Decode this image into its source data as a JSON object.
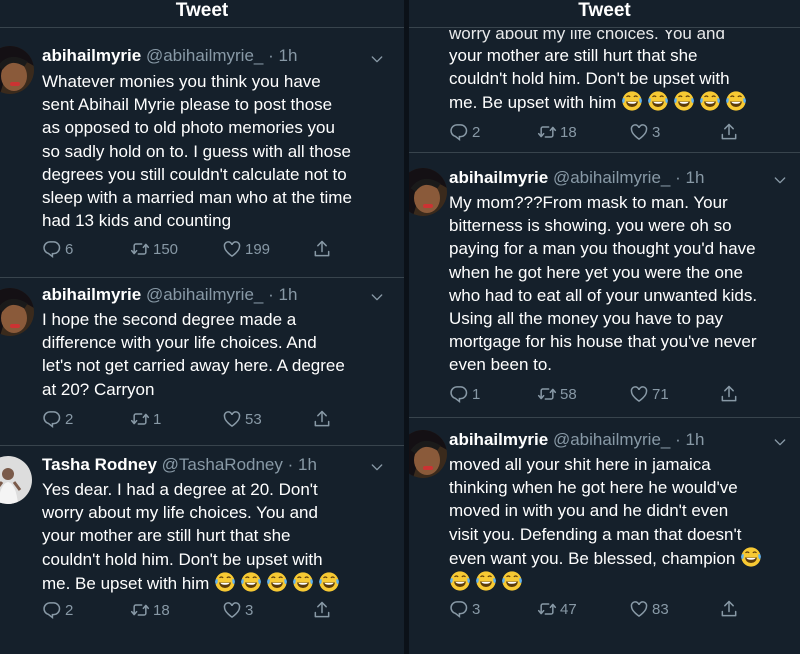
{
  "left": {
    "header": "Tweet",
    "tweets": [
      {
        "name": "abihailmyrie",
        "handle": "@abihailmyrie_",
        "time": "· 1h",
        "text": "Whatever monies you think you have\nsent Abihail Myrie please to post those\nas opposed to old photo memories you\nso sadly hold on to. I guess with all those\ndegrees you still couldn't calculate not to\nsleep with a married man who at the time\nhad 13 kids and counting",
        "replies": "6",
        "retweets": "150",
        "likes": "199"
      },
      {
        "name": "abihailmyrie",
        "handle": "@abihailmyrie_",
        "time": "· 1h",
        "text": "I hope the second degree made a\ndifference with your life choices. And\nlet's not get carried away here. A degree\nat 20? Carryon",
        "replies": "2",
        "retweets": "1",
        "likes": "53"
      },
      {
        "name": "Tasha Rodney",
        "handle": "@TashaRodney",
        "time": "· 1h",
        "text": "Yes dear. I had a degree at 20. Don't\nworry about my life choices. You and\nyour mother are still hurt that she\ncouldn't hold him. Don't be upset with\nme. Be upset with him",
        "replies": "2",
        "retweets": "18",
        "likes": "3"
      }
    ]
  },
  "right": {
    "header": "Tweet",
    "partial": {
      "cut_text": "worry about my life choices. You and",
      "text": "your mother are still hurt that she\ncouldn't hold him. Don't be upset with\nme. Be upset with him",
      "replies": "2",
      "retweets": "18",
      "likes": "3"
    },
    "tweets": [
      {
        "name": "abihailmyrie",
        "handle": "@abihailmyrie_",
        "time": "· 1h",
        "text": "My mom???From mask to man. Your\nbitterness is showing. you were oh so\npaying for a man you thought you'd have\nwhen he got here yet you were the one\nwho had to eat all of your unwanted kids.\nUsing all the money you have to pay\nmortgage for his house that you've never\neven been to.",
        "replies": "1",
        "retweets": "58",
        "likes": "71"
      },
      {
        "name": "abihailmyrie",
        "handle": "@abihailmyrie_",
        "time": "· 1h",
        "text": "moved all your shit here in jamaica\nthinking when he got here he would've\nmoved in with you and he didn't even\nvisit you. Defending a man that doesn't\neven want you. Be blessed, champion",
        "replies": "3",
        "retweets": "47",
        "likes": "83"
      }
    ]
  },
  "icons": {
    "reply": "reply-icon",
    "retweet": "retweet-icon",
    "like": "heart-icon",
    "share": "share-icon",
    "menu": "chevron-down-icon",
    "emoji": "tears-of-joy-emoji"
  },
  "colors": {
    "background": "#15202b",
    "text": "#ffffff",
    "secondary": "#8899a6",
    "border": "#38444d"
  }
}
